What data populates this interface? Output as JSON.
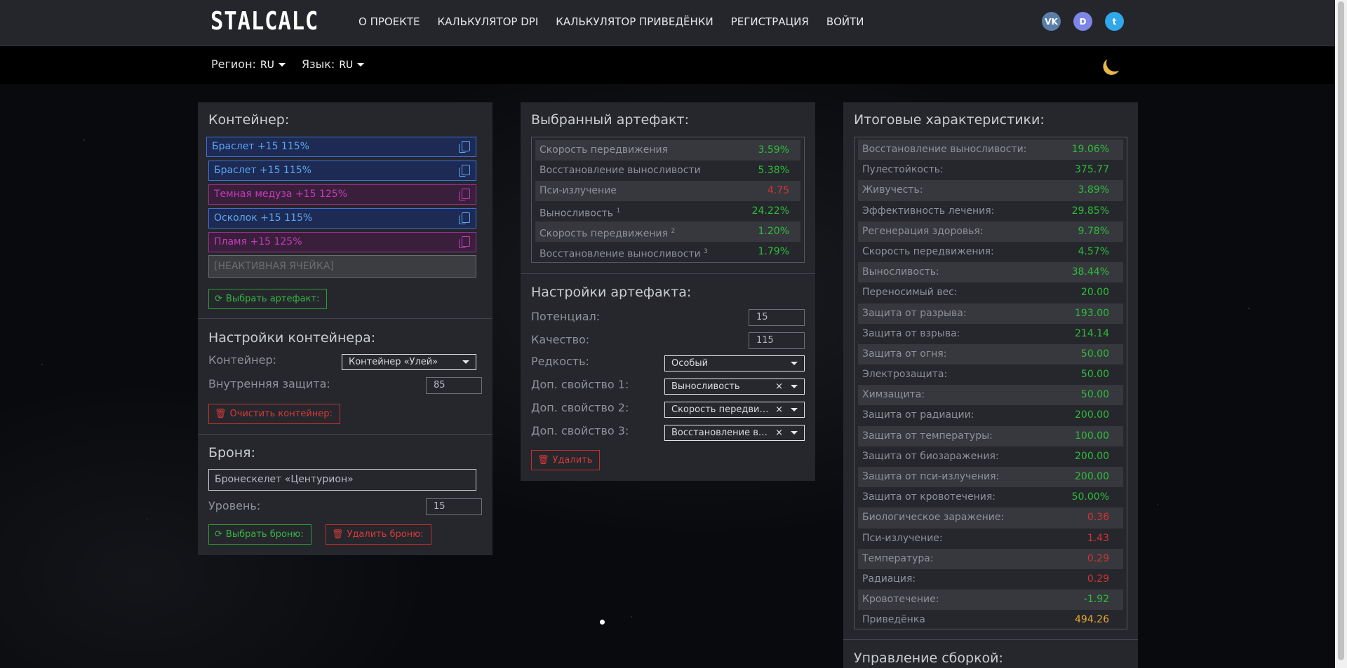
{
  "nav": {
    "logo": "STALCALC",
    "links": [
      "О ПРОЕКТЕ",
      "КАЛЬКУЛЯТОР DPI",
      "КАЛЬКУЛЯТОР ПРИВЕДЁНКИ",
      "РЕГИСТРАЦИЯ",
      "ВОЙТИ"
    ],
    "social": {
      "vk": "VK",
      "discord": "D",
      "twitter": "t"
    }
  },
  "regionbar": {
    "region_label": "Регион:",
    "region_value": "RU",
    "lang_label": "Язык:",
    "lang_value": "RU"
  },
  "container_panel": {
    "title": "Контейнер:",
    "slots": [
      {
        "label": "Браслет +15 115%",
        "style": "blue"
      },
      {
        "label": "Браслет +15 115%",
        "style": "blue"
      },
      {
        "label": "Темная медуза +15 125%",
        "style": "magenta"
      },
      {
        "label": "Осколок +15 115%",
        "style": "blue"
      },
      {
        "label": "Пламя +15 125%",
        "style": "magenta"
      },
      {
        "label": "[НЕАКТИВНАЯ ЯЧЕЙКА]",
        "style": "inactive"
      }
    ],
    "choose_artifact_button": "Выбрать артефакт:",
    "settings_title": "Настройки контейнера:",
    "container_label": "Контейнер:",
    "container_value": "Контейнер «Улей»",
    "inner_protection_label": "Внутренняя защита:",
    "inner_protection_value": "85",
    "clear_button": "Очистить контейнер:",
    "armor_title": "Броня:",
    "armor_value": "Бронескелет «Центурион»",
    "level_label": "Уровень:",
    "level_value": "15",
    "choose_armor_button": "Выбрать броню:",
    "delete_armor_button": "Удалить броню:"
  },
  "artifact_panel": {
    "title": "Выбранный артефакт:",
    "stats": [
      {
        "name": "Скорость передвижения",
        "sup": "",
        "value": "3.59%",
        "color": "green"
      },
      {
        "name": "Восстановление выносливости",
        "sup": "",
        "value": "5.38%",
        "color": "green"
      },
      {
        "name": "Пси-излучение",
        "sup": "",
        "value": "4.75",
        "color": "red"
      },
      {
        "name": "Выносливость",
        "sup": "1",
        "value": "24.22%",
        "color": "green"
      },
      {
        "name": "Скорость передвижения",
        "sup": "2",
        "value": "1.20%",
        "color": "green"
      },
      {
        "name": "Восстановление выносливости",
        "sup": "3",
        "value": "1.79%",
        "color": "green"
      }
    ],
    "settings_title": "Настройки артефакта:",
    "potential_label": "Потенциал:",
    "potential_value": "15",
    "quality_label": "Качество:",
    "quality_value": "115",
    "rarity_label": "Редкость:",
    "rarity_value": "Особый",
    "extra1_label": "Доп. свойство 1:",
    "extra1_value": "Выносливость",
    "extra2_label": "Доп. свойство 2:",
    "extra2_value": "Скорость передвижения",
    "extra3_label": "Доп. свойство 3:",
    "extra3_value": "Восстановление выносливости",
    "clear_x": "×",
    "delete_button": "Удалить"
  },
  "totals_panel": {
    "title": "Итоговые характеристики:",
    "stats": [
      {
        "name": "Восстановление выносливости:",
        "value": "19.06%",
        "color": "green"
      },
      {
        "name": "Пулестойкость:",
        "value": "375.77",
        "color": "green"
      },
      {
        "name": "Живучесть:",
        "value": "3.89%",
        "color": "green"
      },
      {
        "name": "Эффективность лечения:",
        "value": "29.85%",
        "color": "green"
      },
      {
        "name": "Регенерация здоровья:",
        "value": "9.78%",
        "color": "green"
      },
      {
        "name": "Скорость передвижения:",
        "value": "4.57%",
        "color": "green"
      },
      {
        "name": "Выносливость:",
        "value": "38.44%",
        "color": "green"
      },
      {
        "name": "Переносимый вес:",
        "value": "20.00",
        "color": "green"
      },
      {
        "name": "Защита от разрыва:",
        "value": "193.00",
        "color": "green"
      },
      {
        "name": "Защита от взрыва:",
        "value": "214.14",
        "color": "green"
      },
      {
        "name": "Защита от огня:",
        "value": "50.00",
        "color": "green"
      },
      {
        "name": "Электрозащита:",
        "value": "50.00",
        "color": "green"
      },
      {
        "name": "Химзащита:",
        "value": "50.00",
        "color": "green"
      },
      {
        "name": "Защита от радиации:",
        "value": "200.00",
        "color": "green"
      },
      {
        "name": "Защита от температуры:",
        "value": "100.00",
        "color": "green"
      },
      {
        "name": "Защита от биозаражения:",
        "value": "200.00",
        "color": "green"
      },
      {
        "name": "Защита от пси-излучения:",
        "value": "200.00",
        "color": "green"
      },
      {
        "name": "Защита от кровотечения:",
        "value": "50.00%",
        "color": "green"
      },
      {
        "name": "Биологическое заражение:",
        "value": "0.36",
        "color": "red"
      },
      {
        "name": "Пси-излучение:",
        "value": "1.43",
        "color": "red"
      },
      {
        "name": "Температура:",
        "value": "0.29",
        "color": "red"
      },
      {
        "name": "Радиация:",
        "value": "0.29",
        "color": "red"
      },
      {
        "name": "Кровотечение:",
        "value": "-1.92",
        "color": "green"
      },
      {
        "name": "Приведёнка",
        "value": "494.26",
        "color": "gold"
      }
    ],
    "build_title": "Управление сборкой:"
  },
  "colors": {
    "green": "#2ebd3a",
    "red": "#d13434",
    "gold": "#e8a732",
    "blue_slot": "#5aa6f0",
    "magenta_slot": "#c53bb4",
    "moon": "#e8b84a"
  }
}
